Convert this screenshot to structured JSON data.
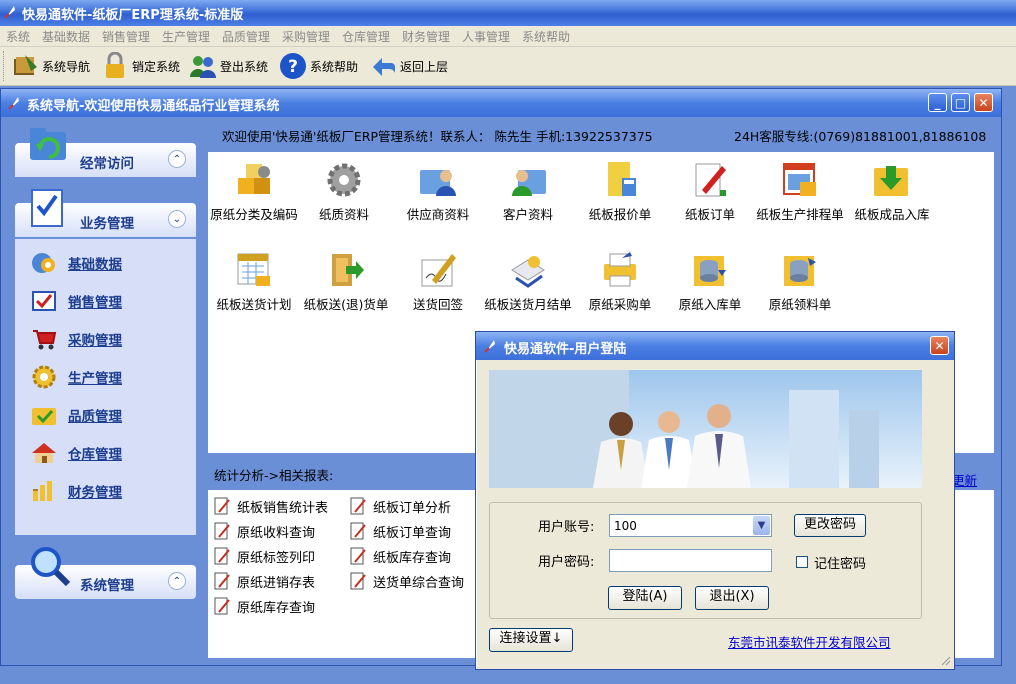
{
  "app": {
    "title": "快易通软件-纸板厂ERP理系统-标准版"
  },
  "menubar": [
    "系统",
    "基础数据",
    "销售管理",
    "生产管理",
    "品质管理",
    "采购管理",
    "仓库管理",
    "财务管理",
    "人事管理",
    "系统帮助"
  ],
  "toolbar": [
    {
      "label": "系统导航",
      "icon": "book-icon"
    },
    {
      "label": "销定系统",
      "icon": "lock-icon"
    },
    {
      "label": "登出系统",
      "icon": "users-icon"
    },
    {
      "label": "系统帮助",
      "icon": "help-icon"
    },
    {
      "label": "返回上层",
      "icon": "back-arrow-icon"
    }
  ],
  "inner_window": {
    "title": "系统导航-欢迎使用快易通纸品行业管理系统",
    "welcome": "欢迎使用'快易通'纸板厂ERP管理系统！联系人：  陈先生  手机:13922537375",
    "hotline": "24H客服专线:(0769)81881001,81886108"
  },
  "sidebar": {
    "frequent": {
      "label": "经常访问",
      "toggle": "⌃"
    },
    "business": {
      "label": "业务管理",
      "toggle": "⌄"
    },
    "system": {
      "label": "系统管理",
      "toggle": "⌃"
    },
    "items": [
      {
        "label": "基础数据",
        "icon": "gear-globe-icon"
      },
      {
        "label": "销售管理",
        "icon": "checkbox-icon"
      },
      {
        "label": "采购管理",
        "icon": "cart-icon"
      },
      {
        "label": "生产管理",
        "icon": "gear-icon"
      },
      {
        "label": "品质管理",
        "icon": "folder-check-icon"
      },
      {
        "label": "仓库管理",
        "icon": "house-icon"
      },
      {
        "label": "财务管理",
        "icon": "coins-icon"
      }
    ]
  },
  "grid": {
    "row1": [
      {
        "label": "原纸分类及编码",
        "icon": "boxes-icon"
      },
      {
        "label": "纸质资料",
        "icon": "gear-icon"
      },
      {
        "label": "供应商资料",
        "icon": "person-folder-icon"
      },
      {
        "label": "客户资料",
        "icon": "person-folder-icon"
      },
      {
        "label": "纸板报价单",
        "icon": "calculator-icon"
      },
      {
        "label": "纸板订单",
        "icon": "pen-doc-icon"
      },
      {
        "label": "纸板生产排程单",
        "icon": "schedule-icon"
      },
      {
        "label": "纸板成品入库",
        "icon": "folder-download-icon"
      }
    ],
    "row2": [
      {
        "label": "纸板送货计划",
        "icon": "calendar-icon"
      },
      {
        "label": "纸板送(退)货单",
        "icon": "door-arrow-icon"
      },
      {
        "label": "送货回签",
        "icon": "sign-icon"
      },
      {
        "label": "纸板送货月结单",
        "icon": "monthly-icon"
      },
      {
        "label": "原纸采购单",
        "icon": "printer-icon"
      },
      {
        "label": "原纸入库单",
        "icon": "database-icon"
      },
      {
        "label": "原纸领料单",
        "icon": "database-icon"
      }
    ]
  },
  "stats": {
    "label": "统计分析->相关报表:",
    "refresh": "更新"
  },
  "reports": {
    "col1": [
      "纸板销售统计表",
      "原纸收料查询",
      "原纸标签列印",
      "原纸进销存表",
      "原纸库存查询"
    ],
    "col2": [
      "纸板订单分析",
      "纸板订单查询",
      "纸板库存查询",
      "送货单综合查询"
    ]
  },
  "login": {
    "title": "快易通软件-用户登陆",
    "account_label": "用户账号:",
    "account_value": "100",
    "password_label": "用户密码:",
    "password_value": "",
    "change_password": "更改密码",
    "remember": "记住密码",
    "login_btn": "登陆(A)",
    "exit_btn": "退出(X)",
    "conn_btn": "连接设置↓",
    "company": "东莞市讯泰软件开发有限公司"
  },
  "colors": {
    "accent": "#3c6fd9",
    "panel": "#6b8fd6",
    "link": "#0000cc",
    "sidebar": "#d6dff7"
  }
}
